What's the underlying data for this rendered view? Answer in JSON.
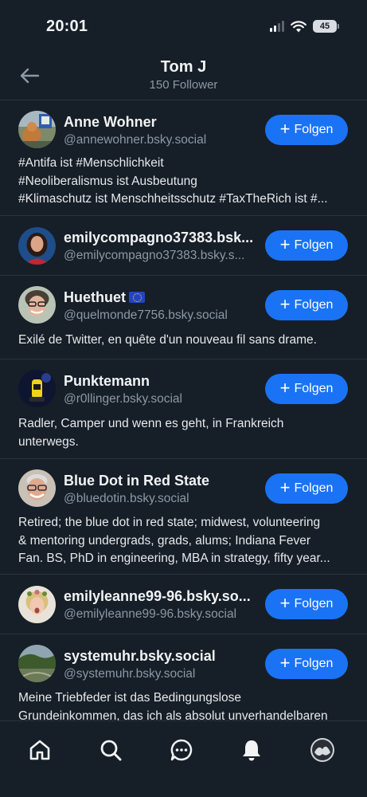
{
  "status_bar": {
    "time": "20:01",
    "battery": "45"
  },
  "header": {
    "title": "Tom J",
    "subtitle": "150 Follower"
  },
  "follow_label": "Folgen",
  "users": [
    {
      "name": "Anne Wohner",
      "handle": "@annewohner.bsky.social",
      "bio": [
        "#Antifa ist #Menschlichkeit",
        "#Neoliberalismus ist Ausbeutung",
        "#Klimaschutz ist Menschheitsschutz #TaxTheRich ist #..."
      ]
    },
    {
      "name": "emilycompagno37383.bsk...",
      "handle": "@emilycompagno37383.bsky.s...",
      "bio": []
    },
    {
      "name": "Huethuet",
      "handle": "@quelmonde7756.bsky.social",
      "bio": [
        "Exilé de Twitter, en quête d'un nouveau fil sans drame."
      ]
    },
    {
      "name": "Punktemann",
      "handle": "@r0llinger.bsky.social",
      "bio": [
        "Radler, Camper und wenn es geht, in Frankreich",
        "unterwegs."
      ]
    },
    {
      "name": "Blue Dot in Red State",
      "handle": "@bluedotin.bsky.social",
      "bio": [
        "Retired; the blue dot in red state; midwest, volunteering",
        "& mentoring undergrads, grads, alums; Indiana Fever",
        "Fan. BS, PhD in engineering, MBA in strategy, fifty year..."
      ]
    },
    {
      "name": "emilyleanne99-96.bsky.so...",
      "handle": "@emilyleanne99-96.bsky.social",
      "bio": []
    },
    {
      "name": "systemuhr.bsky.social",
      "handle": "@systemuhr.bsky.social",
      "bio": [
        "Meine Triebfeder ist das Bedingungslose",
        "Grundeinkommen, das ich als absolut unverhandelbaren"
      ]
    }
  ],
  "tabs": [
    "home-icon",
    "search-icon",
    "chat-icon",
    "notifications-icon",
    "profile-avatar"
  ],
  "colors": {
    "background": "#161e27",
    "accent": "#1a73f5",
    "muted_text": "#8c98a5",
    "divider": "#2a3440"
  }
}
